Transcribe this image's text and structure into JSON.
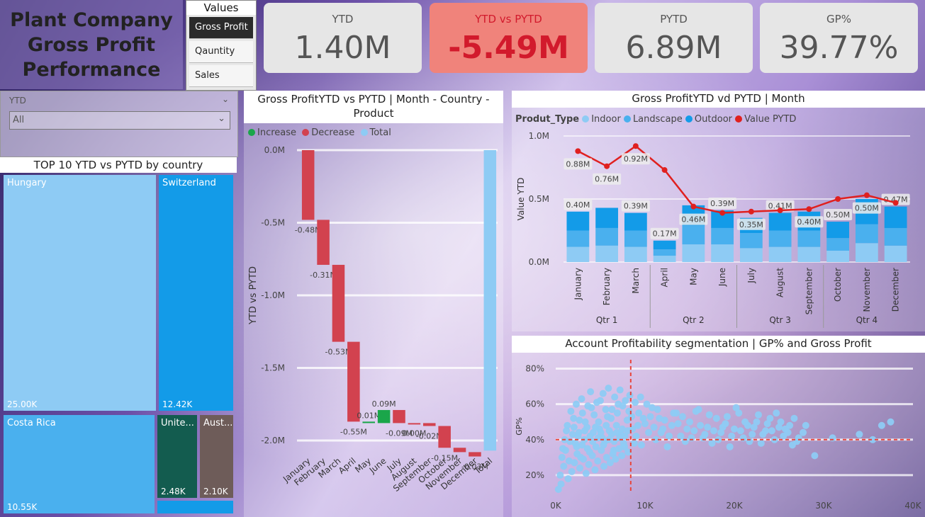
{
  "title": {
    "line1": "Plant Company",
    "line2": "Gross Profit",
    "line3": "Performance"
  },
  "values_slicer": {
    "header": "Values",
    "items": [
      "Gross Profit",
      "Qauntity",
      "Sales"
    ],
    "selected": "Gross Profit"
  },
  "kpis": [
    {
      "label": "YTD",
      "value": "1.40M"
    },
    {
      "label": "YTD vs PYTD",
      "value": "-5.49M"
    },
    {
      "label": "PYTD",
      "value": "6.89M"
    },
    {
      "label": "GP%",
      "value": "39.77%"
    }
  ],
  "ytd_slicer": {
    "label": "YTD",
    "value": "All"
  },
  "treemap": {
    "title": "TOP 10 YTD vs PYTD by country",
    "items": [
      {
        "name": "Hungary",
        "value": "25.00K",
        "color": "#8ecbf4"
      },
      {
        "name": "Switzerland",
        "value": "12.42K",
        "color": "#139be8"
      },
      {
        "name": "Costa Rica",
        "value": "10.55K",
        "color": "#4ab0ee"
      },
      {
        "name": "Unite...",
        "value": "2.48K",
        "color": "#135c4f"
      },
      {
        "name": "Aust...",
        "value": "2.10K",
        "color": "#6e5c59"
      },
      {
        "name": "",
        "value": "",
        "color": "#139be8"
      }
    ]
  },
  "waterfall": {
    "title_line1": "Gross ProfitYTD vs PYTD | Month - Country -",
    "title_line2": "Product",
    "legend": [
      {
        "name": "Increase",
        "color": "#1aa64a"
      },
      {
        "name": "Decrease",
        "color": "#d2424f"
      },
      {
        "name": "Total",
        "color": "#8ecbf4"
      }
    ]
  },
  "combo": {
    "title": "Gross ProfitYTD vd PYTD | Month",
    "legend_title": "Produt_Type",
    "legend": [
      {
        "name": "Indoor",
        "color": "#8ecbf4"
      },
      {
        "name": "Landscape",
        "color": "#4ab0ee"
      },
      {
        "name": "Outdoor",
        "color": "#139be8"
      },
      {
        "name": "Value PYTD",
        "color": "#e0201f"
      }
    ],
    "quarters": [
      "Qtr 1",
      "Qtr 2",
      "Qtr 3",
      "Qtr 4"
    ]
  },
  "scatter": {
    "title": "Account Profitability segmentation | GP% and Gross Profit"
  },
  "chart_data": [
    {
      "type": "bar",
      "subtype": "waterfall",
      "ylabel": "YTD vs PYTD",
      "yticks": [
        "0.0M",
        "-0.5M",
        "-1.0M",
        "-1.5M",
        "-2.0M"
      ],
      "ylim": [
        -2.0,
        0.0
      ],
      "categories": [
        "January",
        "February",
        "March",
        "April",
        "May",
        "June",
        "July",
        "August",
        "September",
        "October",
        "November",
        "December",
        "Total"
      ],
      "values": [
        -0.48,
        -0.31,
        -0.53,
        -0.55,
        -0.01,
        0.09,
        -0.09,
        0.0,
        -0.02,
        -0.15,
        -0.03,
        -0.03,
        -2.07
      ],
      "labels": [
        "-0.48M",
        "-0.31M",
        "-0.53M",
        "-0.55M",
        "0.01M",
        "0.09M",
        "-0.09M",
        "0.00M",
        "-0.02M",
        "-0.15M",
        "",
        "-0.03M",
        ""
      ],
      "kinds": [
        "decrease",
        "decrease",
        "decrease",
        "decrease",
        "increase",
        "increase",
        "decrease",
        "decrease",
        "decrease",
        "decrease",
        "decrease",
        "decrease",
        "total"
      ]
    },
    {
      "type": "bar",
      "subtype": "stacked-bar-with-line",
      "ylabel": "Value YTD",
      "yticks": [
        "1.0M",
        "0.5M",
        "0.0M"
      ],
      "ylim": [
        0,
        1.0
      ],
      "categories": [
        "January",
        "February",
        "March",
        "April",
        "May",
        "June",
        "July",
        "August",
        "September",
        "October",
        "November",
        "December"
      ],
      "series": [
        {
          "name": "Indoor",
          "values": [
            0.12,
            0.13,
            0.12,
            0.05,
            0.14,
            0.14,
            0.11,
            0.12,
            0.12,
            0.09,
            0.15,
            0.13
          ]
        },
        {
          "name": "Landscape",
          "values": [
            0.13,
            0.14,
            0.13,
            0.05,
            0.15,
            0.13,
            0.12,
            0.13,
            0.13,
            0.1,
            0.15,
            0.14
          ]
        },
        {
          "name": "Outdoor",
          "values": [
            0.15,
            0.16,
            0.14,
            0.07,
            0.16,
            0.14,
            0.12,
            0.14,
            0.15,
            0.13,
            0.2,
            0.17
          ]
        },
        {
          "name": "Value PYTD",
          "values": [
            0.88,
            0.76,
            0.92,
            0.73,
            0.44,
            0.39,
            0.4,
            0.41,
            0.42,
            0.5,
            0.53,
            0.47
          ]
        }
      ],
      "bar_labels": [
        "0.40M",
        "",
        "0.39M",
        "0.17M",
        "",
        "0.39M",
        "",
        "0.41M",
        "",
        "0.50M",
        "",
        "0.47M"
      ],
      "line_labels": [
        "0.88M",
        "0.76M",
        "0.92M",
        "",
        "0.46M",
        "",
        "0.35M",
        "",
        "0.40M",
        "",
        "0.50M",
        ""
      ]
    },
    {
      "type": "scatter",
      "xlabel": "",
      "ylabel": "GP%",
      "xticks": [
        "0K",
        "10K",
        "20K",
        "30K",
        "40K"
      ],
      "yticks": [
        "80%",
        "60%",
        "40%",
        "20%"
      ],
      "xlim": [
        0,
        40000
      ],
      "ylim": [
        10,
        85
      ],
      "ref_x": 8400,
      "ref_y": 40,
      "points": [
        [
          500,
          20
        ],
        [
          800,
          35
        ],
        [
          1200,
          45
        ],
        [
          1500,
          28
        ],
        [
          2000,
          52
        ],
        [
          2200,
          38
        ],
        [
          2500,
          42
        ],
        [
          2800,
          30
        ],
        [
          3000,
          55
        ],
        [
          3200,
          40
        ],
        [
          3500,
          47
        ],
        [
          3800,
          33
        ],
        [
          4000,
          58
        ],
        [
          4200,
          44
        ],
        [
          4500,
          36
        ],
        [
          4800,
          50
        ],
        [
          5000,
          62
        ],
        [
          5200,
          41
        ],
        [
          5500,
          39
        ],
        [
          5800,
          53
        ],
        [
          6000,
          45
        ],
        [
          6300,
          57
        ],
        [
          6500,
          34
        ],
        [
          6800,
          48
        ],
        [
          7000,
          60
        ],
        [
          7300,
          43
        ],
        [
          7600,
          38
        ],
        [
          8000,
          51
        ],
        [
          8300,
          65
        ],
        [
          8600,
          46
        ],
        [
          9000,
          42
        ],
        [
          9300,
          55
        ],
        [
          9600,
          37
        ],
        [
          10000,
          49
        ],
        [
          10400,
          44
        ],
        [
          10800,
          58
        ],
        [
          11200,
          40
        ],
        [
          11600,
          52
        ],
        [
          12000,
          46
        ],
        [
          12500,
          36
        ],
        [
          13000,
          48
        ],
        [
          13500,
          55
        ],
        [
          14000,
          42
        ],
        [
          14500,
          39
        ],
        [
          15000,
          50
        ],
        [
          15500,
          45
        ],
        [
          16000,
          57
        ],
        [
          16500,
          41
        ],
        [
          17000,
          47
        ],
        [
          17500,
          38
        ],
        [
          18000,
          52
        ],
        [
          18500,
          44
        ],
        [
          19000,
          49
        ],
        [
          19500,
          36
        ],
        [
          20000,
          46
        ],
        [
          20500,
          55
        ],
        [
          21000,
          41
        ],
        [
          21500,
          48
        ],
        [
          22000,
          43
        ],
        [
          22500,
          50
        ],
        [
          23000,
          38
        ],
        [
          23500,
          45
        ],
        [
          24000,
          52
        ],
        [
          24500,
          40
        ],
        [
          25000,
          47
        ],
        [
          25500,
          42
        ],
        [
          26000,
          44
        ],
        [
          26500,
          37
        ],
        [
          27000,
          39
        ],
        [
          28000,
          48
        ],
        [
          29000,
          31
        ],
        [
          31000,
          41
        ],
        [
          34000,
          43
        ],
        [
          35500,
          40
        ],
        [
          36500,
          48
        ],
        [
          37500,
          50
        ],
        [
          600,
          15
        ],
        [
          900,
          25
        ],
        [
          1400,
          18
        ],
        [
          1800,
          22
        ],
        [
          2100,
          27
        ],
        [
          2400,
          32
        ],
        [
          2700,
          24
        ],
        [
          3100,
          29
        ],
        [
          3400,
          21
        ],
        [
          3700,
          26
        ],
        [
          4100,
          31
        ],
        [
          4400,
          23
        ],
        [
          4700,
          28
        ],
        [
          5100,
          34
        ],
        [
          5400,
          25
        ],
        [
          5700,
          30
        ],
        [
          6100,
          27
        ],
        [
          6400,
          32
        ],
        [
          6700,
          29
        ],
        [
          7100,
          35
        ],
        [
          7400,
          31
        ],
        [
          7700,
          36
        ],
        [
          8100,
          33
        ],
        [
          8800,
          38
        ],
        [
          1000,
          40
        ],
        [
          1300,
          48
        ],
        [
          1700,
          56
        ],
        [
          2300,
          60
        ],
        [
          2600,
          44
        ],
        [
          2900,
          63
        ],
        [
          3300,
          50
        ],
        [
          3600,
          59
        ],
        [
          3900,
          67
        ],
        [
          4300,
          54
        ],
        [
          4600,
          61
        ],
        [
          4900,
          46
        ],
        [
          5300,
          66
        ],
        [
          5600,
          57
        ],
        [
          5900,
          69
        ],
        [
          6200,
          52
        ],
        [
          6600,
          64
        ],
        [
          6900,
          55
        ],
        [
          7200,
          68
        ],
        [
          7500,
          59
        ],
        [
          7800,
          62
        ],
        [
          8200,
          56
        ],
        [
          8500,
          53
        ],
        [
          8900,
          61
        ],
        [
          9200,
          48
        ],
        [
          9500,
          64
        ],
        [
          9800,
          52
        ],
        [
          10200,
          60
        ],
        [
          10600,
          53
        ],
        [
          11000,
          47
        ],
        [
          11400,
          57
        ],
        [
          11800,
          44
        ],
        [
          12200,
          51
        ],
        [
          12700,
          42
        ],
        [
          13200,
          55
        ],
        [
          13700,
          49
        ],
        [
          14200,
          53
        ],
        [
          14700,
          46
        ],
        [
          15200,
          41
        ],
        [
          15700,
          56
        ],
        [
          16200,
          48
        ],
        [
          16700,
          43
        ],
        [
          17200,
          54
        ],
        [
          17700,
          45
        ],
        [
          18200,
          40
        ],
        [
          18700,
          47
        ],
        [
          19200,
          53
        ],
        [
          19700,
          42
        ],
        [
          20200,
          58
        ],
        [
          20700,
          45
        ],
        [
          21200,
          50
        ],
        [
          21700,
          39
        ],
        [
          22200,
          47
        ],
        [
          22700,
          54
        ],
        [
          23200,
          43
        ],
        [
          23700,
          49
        ],
        [
          24200,
          45
        ],
        [
          24700,
          55
        ],
        [
          25200,
          50
        ],
        [
          25700,
          46
        ],
        [
          26200,
          48
        ],
        [
          26700,
          52
        ],
        [
          27200,
          41
        ],
        [
          27700,
          44
        ],
        [
          300,
          12
        ],
        [
          700,
          30
        ],
        [
          1100,
          34
        ],
        [
          1600,
          39
        ],
        [
          1900,
          43
        ],
        [
          2050,
          47
        ],
        [
          2350,
          36
        ],
        [
          2650,
          51
        ],
        [
          2950,
          37
        ],
        [
          3250,
          45
        ],
        [
          3550,
          35
        ],
        [
          3850,
          42
        ],
        [
          4150,
          39
        ],
        [
          4450,
          47
        ],
        [
          4750,
          41
        ],
        [
          5050,
          44
        ],
        [
          5350,
          37
        ],
        [
          5650,
          48
        ],
        [
          5950,
          40
        ],
        [
          6250,
          43
        ],
        [
          6550,
          39
        ],
        [
          6850,
          44
        ],
        [
          7150,
          41
        ],
        [
          7450,
          46
        ],
        [
          7750,
          42
        ],
        [
          8050,
          45
        ]
      ]
    }
  ]
}
